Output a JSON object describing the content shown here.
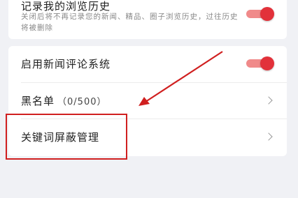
{
  "history_card": {
    "title": "记录我的浏览历史",
    "description": "关闭后将不再记录您的新闻、精品、圈子浏览历史，过往历史将被删除",
    "toggle_on": true
  },
  "settings_card": {
    "comment_system_label": "启用新闻评论系统",
    "comment_system_on": true,
    "blacklist_label": "黑名单",
    "blacklist_count": "（0/500）",
    "keyword_block_label": "关键词屏蔽管理"
  },
  "colors": {
    "accent": "#e2313a",
    "annotation": "#d01f1f"
  }
}
